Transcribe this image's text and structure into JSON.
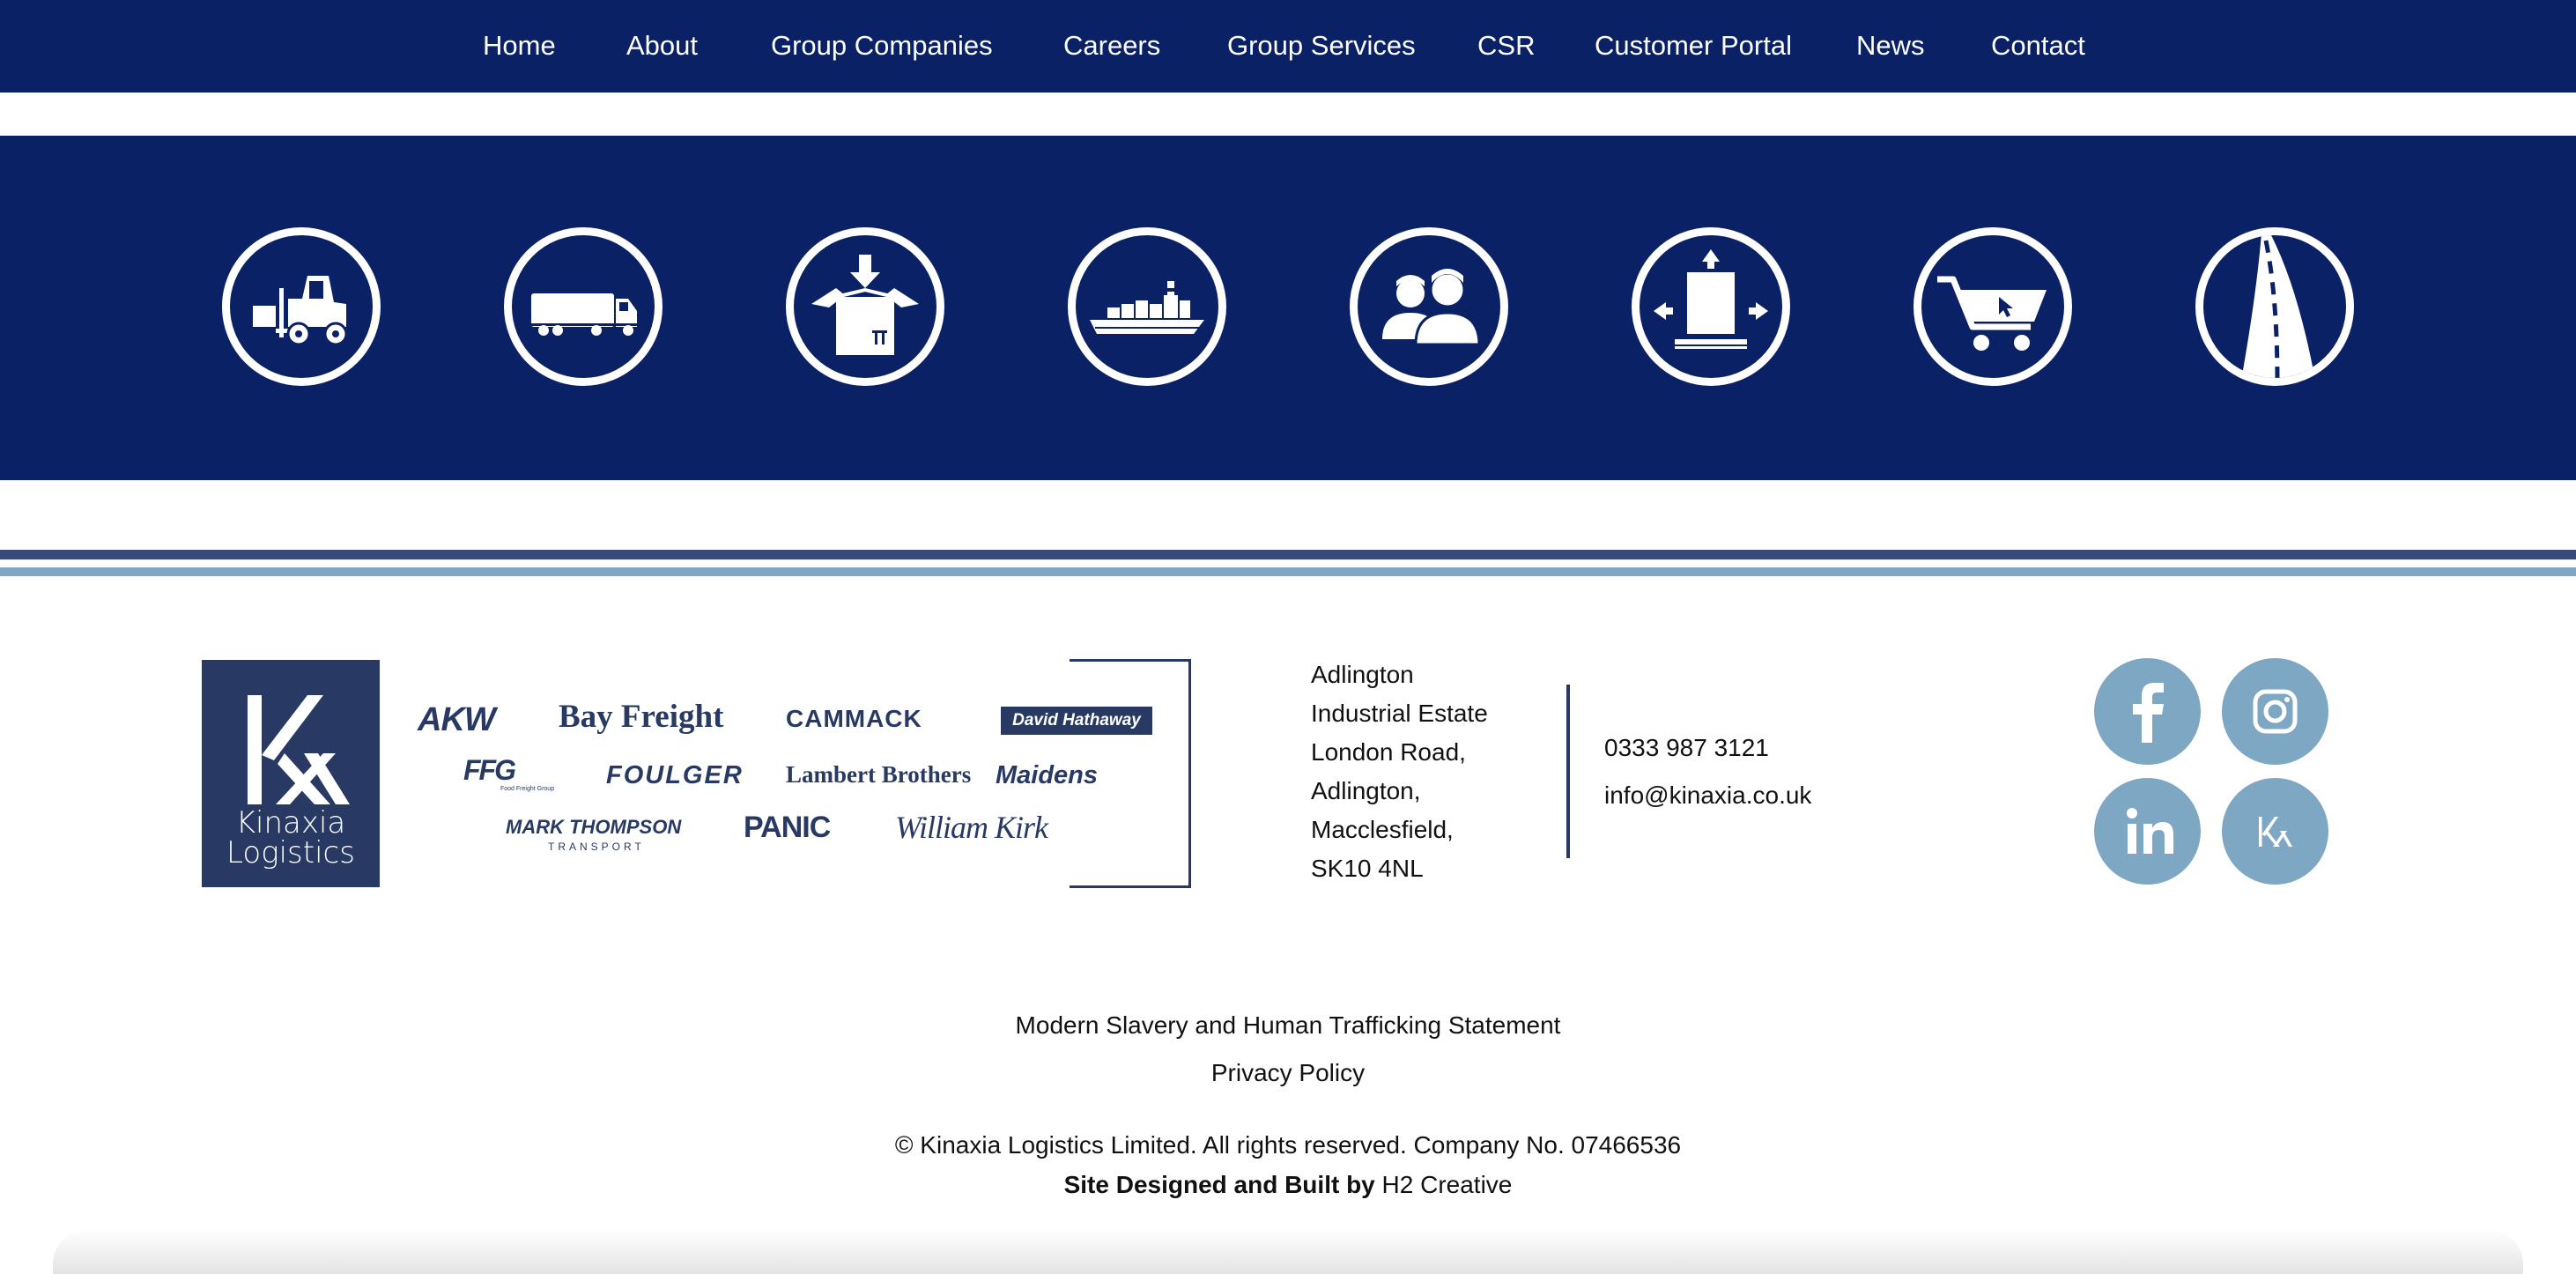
{
  "nav": {
    "items": [
      "Home",
      "About",
      "Group Companies",
      "Careers",
      "Group Services",
      "CSR",
      "Customer Portal",
      "News",
      "Contact"
    ]
  },
  "services": {
    "icons": [
      "forklift-icon",
      "truck-icon",
      "box-icon",
      "cargo-ship-icon",
      "people-icon",
      "pallet-icon",
      "shopping-cart-icon",
      "road-icon"
    ]
  },
  "logo": {
    "line1": "Kinaxia",
    "line2": "Logistics"
  },
  "brands": {
    "akw": "AKW",
    "bay_freight": "Bay Freight",
    "cammack": "CAMMACK",
    "david_hathaway": "David Hathaway",
    "ffg": "FFG",
    "ffg_sub": "Food Freight Group",
    "foulger": "FOULGER",
    "lambert": "Lambert Brothers",
    "maidens": "Maidens",
    "mark_thompson": "MARK THOMPSON",
    "mark_thompson_sub": "TRANSPORT",
    "panic": "PANIC",
    "william_kirk": "William Kirk"
  },
  "address": {
    "lines": [
      "Adlington",
      "Industrial Estate",
      "London Road,",
      "Adlington,",
      "Macclesfield,",
      "SK10 4NL"
    ]
  },
  "contact": {
    "phone": "0333 987 3121",
    "email": "info@kinaxia.co.uk"
  },
  "social": {
    "icons": [
      "facebook-icon",
      "instagram-icon",
      "linkedin-icon",
      "kinaxia-icon"
    ]
  },
  "legal": {
    "modern_slavery": "Modern Slavery and Human Trafficking Statement",
    "privacy": "Privacy Policy",
    "copyright": "© Kinaxia Logistics Limited. All rights reserved. Company No. 07466536",
    "credit_prefix": "Site Designed and Built by",
    "credit_name": "H2 Creative"
  },
  "colors": {
    "navy": "#0a2166",
    "logo_navy": "#283a63",
    "social_blue": "#7ea7c4",
    "stripe_dark": "#39497a"
  }
}
